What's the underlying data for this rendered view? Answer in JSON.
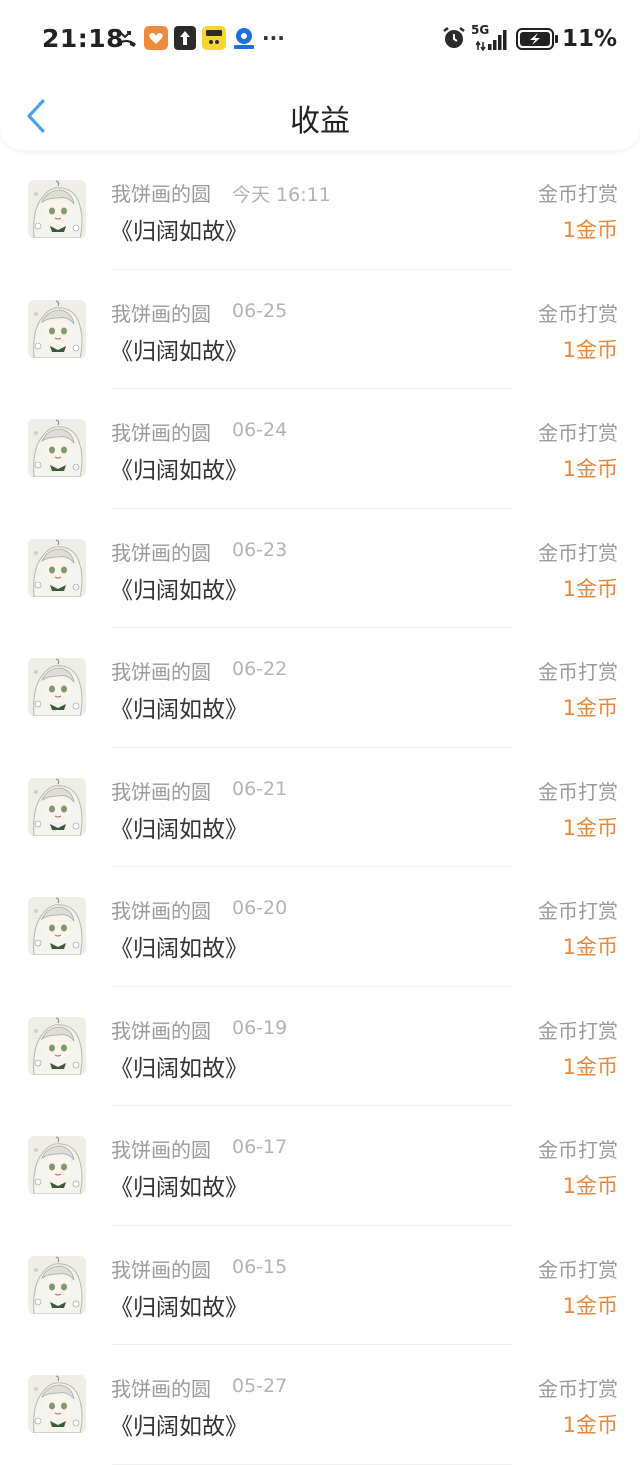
{
  "status_bar": {
    "time": "21:18",
    "network": "5G",
    "battery": "11%",
    "more": "···",
    "icons": [
      "missed-call-icon",
      "heart-app-icon",
      "upload-app-icon",
      "yellow-app-icon",
      "map-app-icon",
      "alarm-icon",
      "signal-icon",
      "battery-charging-icon"
    ]
  },
  "header": {
    "title": "收益",
    "back_icon": "chevron-left-icon"
  },
  "colors": {
    "accent_back": "#4aa3e8",
    "amount": "#e8883c",
    "muted_text": "#9a9a9a",
    "primary_text": "#333333"
  },
  "records": [
    {
      "name": "我饼画的圆",
      "date": "今天 16:11",
      "book": "《归阔如故》",
      "type": "金币打赏",
      "amount": "1金币"
    },
    {
      "name": "我饼画的圆",
      "date": "06-25",
      "book": "《归阔如故》",
      "type": "金币打赏",
      "amount": "1金币"
    },
    {
      "name": "我饼画的圆",
      "date": "06-24",
      "book": "《归阔如故》",
      "type": "金币打赏",
      "amount": "1金币"
    },
    {
      "name": "我饼画的圆",
      "date": "06-23",
      "book": "《归阔如故》",
      "type": "金币打赏",
      "amount": "1金币"
    },
    {
      "name": "我饼画的圆",
      "date": "06-22",
      "book": "《归阔如故》",
      "type": "金币打赏",
      "amount": "1金币"
    },
    {
      "name": "我饼画的圆",
      "date": "06-21",
      "book": "《归阔如故》",
      "type": "金币打赏",
      "amount": "1金币"
    },
    {
      "name": "我饼画的圆",
      "date": "06-20",
      "book": "《归阔如故》",
      "type": "金币打赏",
      "amount": "1金币"
    },
    {
      "name": "我饼画的圆",
      "date": "06-19",
      "book": "《归阔如故》",
      "type": "金币打赏",
      "amount": "1金币"
    },
    {
      "name": "我饼画的圆",
      "date": "06-17",
      "book": "《归阔如故》",
      "type": "金币打赏",
      "amount": "1金币"
    },
    {
      "name": "我饼画的圆",
      "date": "06-15",
      "book": "《归阔如故》",
      "type": "金币打赏",
      "amount": "1金币"
    },
    {
      "name": "我饼画的圆",
      "date": "05-27",
      "book": "《归阔如故》",
      "type": "金币打赏",
      "amount": "1金币"
    }
  ]
}
